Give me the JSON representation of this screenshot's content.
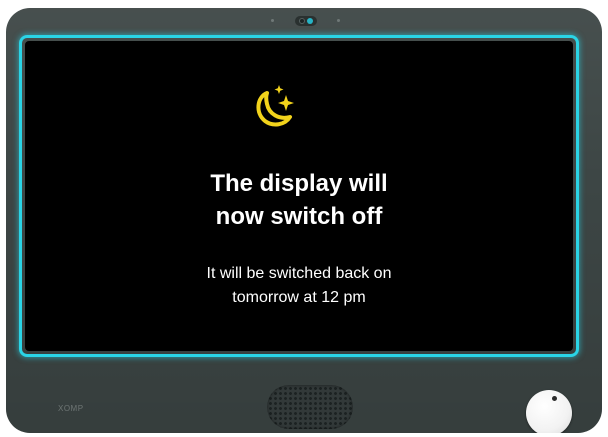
{
  "screen": {
    "icon": "moon-stars-icon",
    "title_line1": "The display will",
    "title_line2": "now switch off",
    "subtitle_line1": "It will be switched back on",
    "subtitle_line2": "tomorrow at 12 pm"
  },
  "device": {
    "brand_label": "XOMP"
  },
  "colors": {
    "bezel": "#3d4645",
    "screen_glow": "#2ad4e6",
    "screen_background": "#000000",
    "icon": "#f2d31b",
    "text": "#ffffff",
    "knob": "#f2f2f2"
  }
}
